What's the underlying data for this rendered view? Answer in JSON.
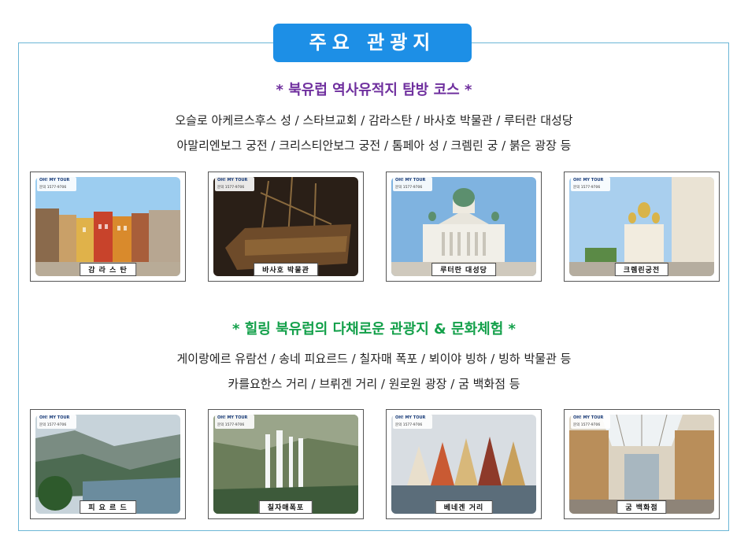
{
  "title": "주요 관광지",
  "section1": {
    "heading": "* 북유럽 역사유적지 탐방 코스 *",
    "line1": "오슬로 아케르스후스 성 / 스타브교회 / 감라스탄 / 바사호 박물관 / 루터란 대성당",
    "line2": "아말리엔보그 궁전 / 크리스티안보그 궁전 / 톰페아 성 / 크렘린 궁 / 붉은 광장 등",
    "photos": [
      {
        "caption": "감 라 스 탄"
      },
      {
        "caption": "바사호 박물관"
      },
      {
        "caption": "루터란 대성당"
      },
      {
        "caption": "크렘린궁전"
      }
    ]
  },
  "section2": {
    "heading": "* 힐링 북유럽의 다채로운 관광지 & 문화체험 *",
    "line1": "게이랑에르 유람선 / 송네 피요르드 / 칠자매 폭포 / 뵈이야 빙하 / 빙하 박물관 등",
    "line2": "카를요한스 거리 / 브뤼겐 거리 / 원로원 광장 / 굼 백화점 등",
    "photos": [
      {
        "caption": "피 요 르 드"
      },
      {
        "caption": "칠자매폭포"
      },
      {
        "caption": "베네겐 거리"
      },
      {
        "caption": "굼 백화점"
      }
    ]
  },
  "logo": {
    "name": "OH! MY TOUR",
    "phone": "문의 1577-9706"
  }
}
